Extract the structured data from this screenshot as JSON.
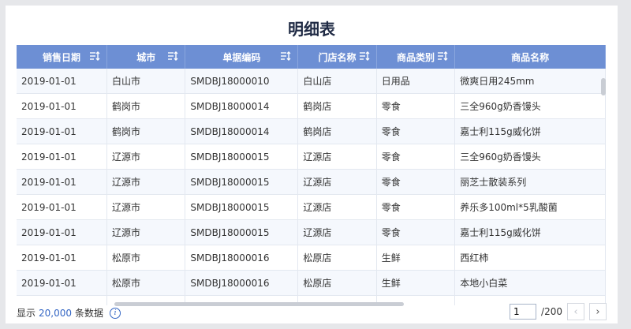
{
  "title": "明细表",
  "columns": [
    {
      "label": "销售日期",
      "sortable": true
    },
    {
      "label": "城市",
      "sortable": true
    },
    {
      "label": "单据编码",
      "sortable": true
    },
    {
      "label": "门店名称",
      "sortable": true
    },
    {
      "label": "商品类别",
      "sortable": true
    },
    {
      "label": "商品名称",
      "sortable": false
    }
  ],
  "rows": [
    [
      "2019-01-01",
      "白山市",
      "SMDBJ18000010",
      "白山店",
      "日用品",
      "微爽日用245mm"
    ],
    [
      "2019-01-01",
      "鹤岗市",
      "SMDBJ18000014",
      "鹤岗店",
      "零食",
      "三全960g奶香馒头"
    ],
    [
      "2019-01-01",
      "鹤岗市",
      "SMDBJ18000014",
      "鹤岗店",
      "零食",
      "嘉士利115g威化饼"
    ],
    [
      "2019-01-01",
      "辽源市",
      "SMDBJ18000015",
      "辽源店",
      "零食",
      "三全960g奶香馒头"
    ],
    [
      "2019-01-01",
      "辽源市",
      "SMDBJ18000015",
      "辽源店",
      "零食",
      "丽芝士散装系列"
    ],
    [
      "2019-01-01",
      "辽源市",
      "SMDBJ18000015",
      "辽源店",
      "零食",
      "养乐多100ml*5乳酸菌"
    ],
    [
      "2019-01-01",
      "辽源市",
      "SMDBJ18000015",
      "辽源店",
      "零食",
      "嘉士利115g威化饼"
    ],
    [
      "2019-01-01",
      "松原市",
      "SMDBJ18000016",
      "松原店",
      "生鲜",
      "西红柿"
    ],
    [
      "2019-01-01",
      "松原市",
      "SMDBJ18000016",
      "松原店",
      "生鲜",
      "本地小白菜"
    ],
    [
      "",
      "",
      "",
      "",
      "",
      ""
    ]
  ],
  "footer": {
    "prefix": "显示",
    "count": "20,000",
    "suffix": "条数据",
    "info_icon": "info-icon"
  },
  "pager": {
    "current_page": "1",
    "total_pages": "/200",
    "prev_icon": "chevron-left-icon",
    "next_icon": "chevron-right-icon"
  },
  "colors": {
    "header_bg": "#6d8fd4",
    "accent": "#3466c4",
    "row_alt": "#f5f8fd"
  }
}
